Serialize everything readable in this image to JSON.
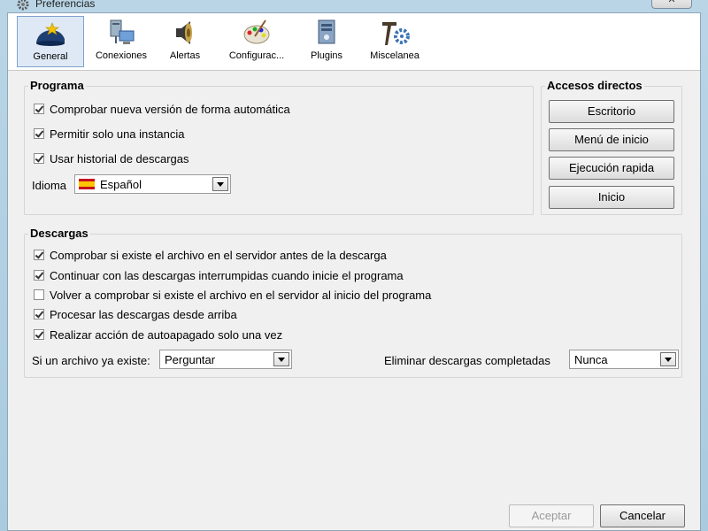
{
  "window": {
    "title": "Preferencias",
    "close_label": "✕"
  },
  "toolbar": {
    "items": [
      {
        "label": "General",
        "icon": "home-icon",
        "active": true
      },
      {
        "label": "Conexiones",
        "icon": "network-icon"
      },
      {
        "label": "Alertas",
        "icon": "speaker-icon"
      },
      {
        "label": "Configurac...",
        "icon": "palette-icon"
      },
      {
        "label": "Plugins",
        "icon": "plugin-icon"
      },
      {
        "label": "Miscelanea",
        "icon": "tools-icon"
      }
    ]
  },
  "programa": {
    "title": "Programa",
    "checks": [
      {
        "label": "Comprobar nueva versión de forma automática",
        "checked": true
      },
      {
        "label": "Permitir solo una instancia",
        "checked": true
      },
      {
        "label": "Usar historial de descargas",
        "checked": true
      }
    ],
    "idioma_label": "Idioma",
    "idioma_value": "Español"
  },
  "accesos": {
    "title": "Accesos directos",
    "buttons": [
      "Escritorio",
      "Menú de inicio",
      "Ejecución rapida",
      "Inicio"
    ]
  },
  "descargas": {
    "title": "Descargas",
    "checks": [
      {
        "label": "Comprobar si existe el archivo en el servidor antes de la descarga",
        "checked": true
      },
      {
        "label": "Continuar con las descargas interrumpidas cuando inicie el programa",
        "checked": true
      },
      {
        "label": "Volver a comprobar si existe el archivo en el servidor al inicio del programa",
        "checked": false
      },
      {
        "label": "Procesar las descargas desde arriba",
        "checked": true
      },
      {
        "label": "Realizar acción de autoapagado solo una vez",
        "checked": true
      }
    ],
    "exists_label": "Si un archivo ya existe:",
    "exists_value": "Perguntar",
    "delete_label": "Eliminar descargas completadas",
    "delete_value": "Nunca"
  },
  "footer": {
    "accept": "Aceptar",
    "cancel": "Cancelar"
  }
}
